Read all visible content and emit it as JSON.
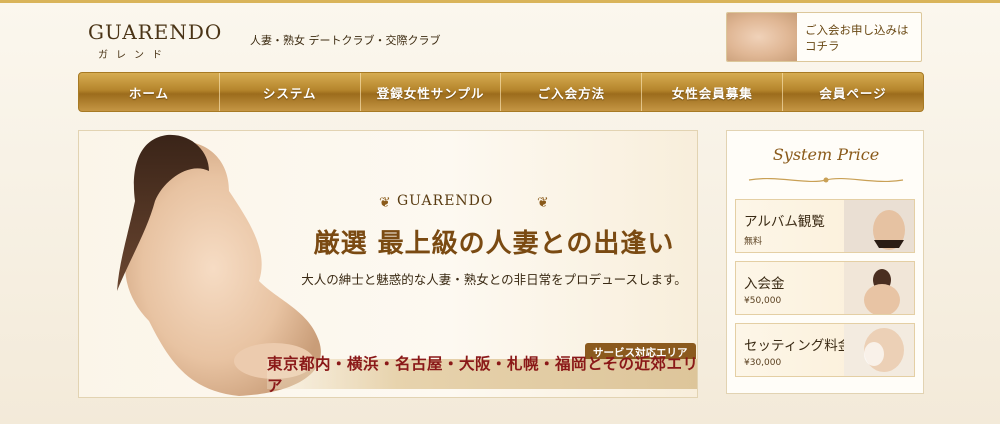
{
  "header": {
    "logo_main": "GUARENDO",
    "logo_kana": "ガレンド",
    "tagline": "人妻・熟女 デートクラブ・交際クラブ",
    "apply_line1": "ご入会お申し込みは",
    "apply_line2": "コチラ"
  },
  "nav": {
    "items": [
      {
        "label": "ホーム"
      },
      {
        "label": "システム"
      },
      {
        "label": "登録女性サンプル"
      },
      {
        "label": "ご入会方法"
      },
      {
        "label": "女性会員募集"
      },
      {
        "label": "会員ページ"
      }
    ]
  },
  "hero": {
    "brand": "GUARENDO",
    "headline": "厳選 最上級の人妻との出逢い",
    "subtitle": "大人の紳士と魅惑的な人妻・熟女との非日常をプロデュースします。",
    "area_label": "サービス対応エリア",
    "area_text": "東京都内・横浜・名古屋・大阪・札幌・福岡とその近郊エリア"
  },
  "price_panel": {
    "title": "System Price",
    "cards": [
      {
        "title": "アルバム観覧",
        "sub": "無料"
      },
      {
        "title": "入会金",
        "sub": "¥50,000"
      },
      {
        "title": "セッティング料金",
        "sub": "¥30,000"
      }
    ]
  },
  "colors": {
    "accent_gold": "#b5852c",
    "headline_brown": "#7a4a12",
    "area_red": "#8a1818"
  }
}
